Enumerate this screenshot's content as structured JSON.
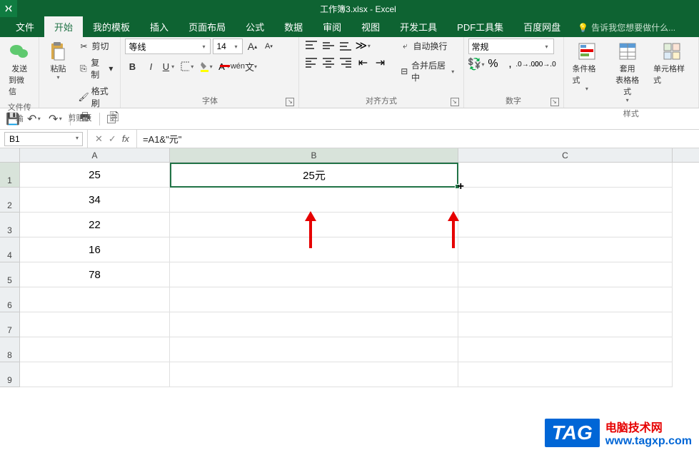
{
  "chart_data": {
    "type": "table",
    "columns": [
      "A",
      "B"
    ],
    "rows": [
      {
        "A": 25,
        "B": "25元"
      },
      {
        "A": 34,
        "B": ""
      },
      {
        "A": 22,
        "B": ""
      },
      {
        "A": 16,
        "B": ""
      },
      {
        "A": 78,
        "B": ""
      }
    ],
    "active_cell": "B1",
    "formula": "=A1&\"元\""
  },
  "title": "工作簿3.xlsx - Excel",
  "tabs": {
    "file": "文件",
    "home": "开始",
    "template": "我的模板",
    "insert": "插入",
    "layout": "页面布局",
    "formula": "公式",
    "data": "数据",
    "review": "审阅",
    "view": "视图",
    "dev": "开发工具",
    "pdf": "PDF工具集",
    "baidu": "百度网盘"
  },
  "tellme": "告诉我您想要做什么...",
  "ribbon": {
    "wechat": {
      "send": "发送",
      "to": "到微信",
      "group": "文件传输"
    },
    "clipboard": {
      "paste": "粘贴",
      "cut": "剪切",
      "copy": "复制",
      "painter": "格式刷",
      "group": "剪贴板"
    },
    "font": {
      "name": "等线",
      "size": "14",
      "group": "字体"
    },
    "align": {
      "wrap": "自动换行",
      "merge": "合并后居中",
      "group": "对齐方式"
    },
    "number": {
      "format": "常规",
      "group": "数字"
    },
    "styles": {
      "cond": "条件格式",
      "table": "套用\n表格格式",
      "cell": "单元格样式",
      "group": "样式"
    }
  },
  "namebox": "B1",
  "formula": "=A1&\"元\"",
  "columns": {
    "A": "A",
    "B": "B",
    "C": "C"
  },
  "rows": [
    "1",
    "2",
    "3",
    "4",
    "5",
    "6",
    "7",
    "8",
    "9"
  ],
  "cells": {
    "A1": "25",
    "A2": "34",
    "A3": "22",
    "A4": "16",
    "A5": "78",
    "B1": "25元"
  },
  "watermark": {
    "tag": "TAG",
    "line1": "电脑技术网",
    "line2": "www.tagxp.com"
  }
}
